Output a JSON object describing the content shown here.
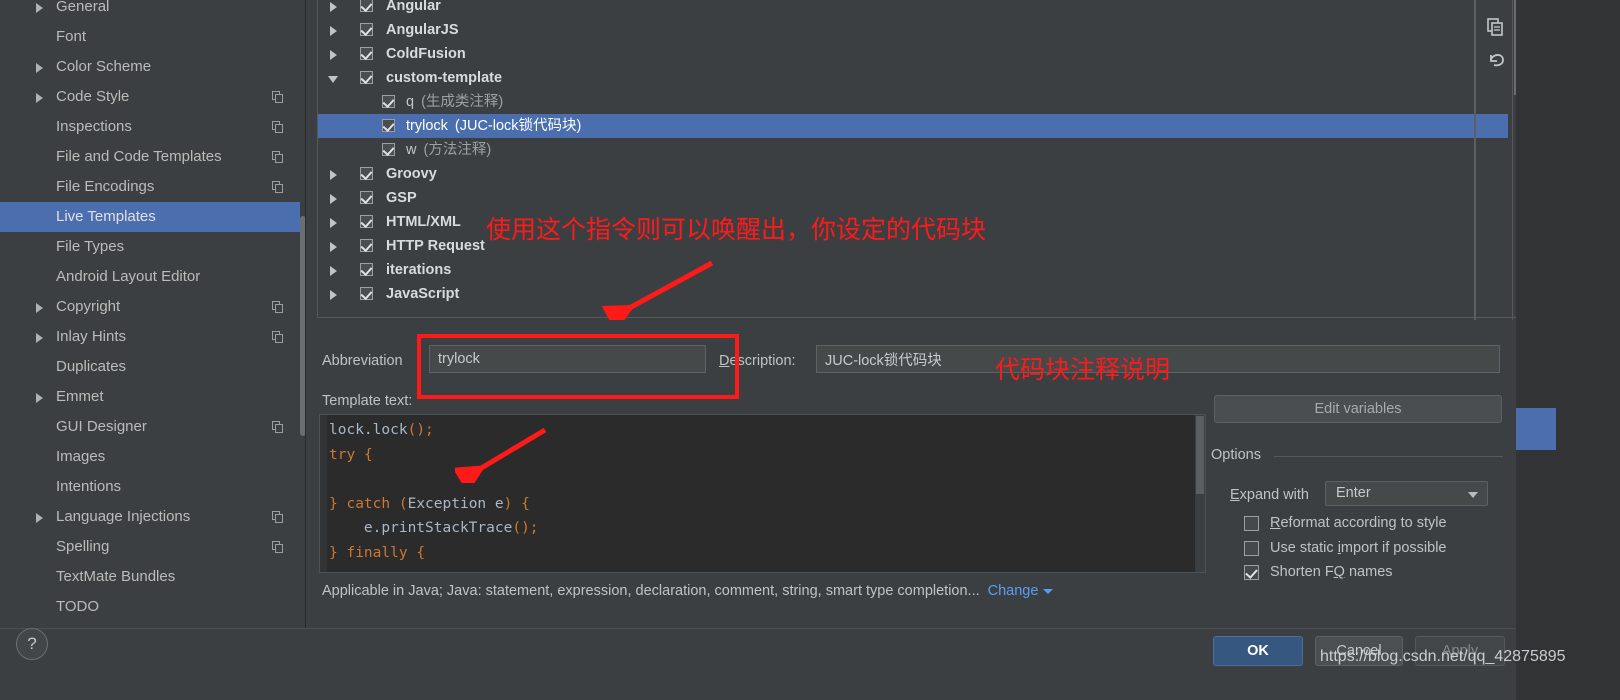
{
  "sidebar": {
    "items": [
      {
        "label": "General",
        "arrow": true,
        "copy": false,
        "selected": false
      },
      {
        "label": "Font",
        "arrow": false,
        "copy": false,
        "selected": false
      },
      {
        "label": "Color Scheme",
        "arrow": true,
        "copy": false,
        "selected": false
      },
      {
        "label": "Code Style",
        "arrow": true,
        "copy": true,
        "selected": false
      },
      {
        "label": "Inspections",
        "arrow": false,
        "copy": true,
        "selected": false
      },
      {
        "label": "File and Code Templates",
        "arrow": false,
        "copy": true,
        "selected": false
      },
      {
        "label": "File Encodings",
        "arrow": false,
        "copy": true,
        "selected": false
      },
      {
        "label": "Live Templates",
        "arrow": false,
        "copy": false,
        "selected": true
      },
      {
        "label": "File Types",
        "arrow": false,
        "copy": false,
        "selected": false
      },
      {
        "label": "Android Layout Editor",
        "arrow": false,
        "copy": false,
        "selected": false
      },
      {
        "label": "Copyright",
        "arrow": true,
        "copy": true,
        "selected": false
      },
      {
        "label": "Inlay Hints",
        "arrow": true,
        "copy": true,
        "selected": false
      },
      {
        "label": "Duplicates",
        "arrow": false,
        "copy": false,
        "selected": false
      },
      {
        "label": "Emmet",
        "arrow": true,
        "copy": false,
        "selected": false
      },
      {
        "label": "GUI Designer",
        "arrow": false,
        "copy": true,
        "selected": false
      },
      {
        "label": "Images",
        "arrow": false,
        "copy": false,
        "selected": false
      },
      {
        "label": "Intentions",
        "arrow": false,
        "copy": false,
        "selected": false
      },
      {
        "label": "Language Injections",
        "arrow": true,
        "copy": true,
        "selected": false
      },
      {
        "label": "Spelling",
        "arrow": false,
        "copy": true,
        "selected": false
      },
      {
        "label": "TextMate Bundles",
        "arrow": false,
        "copy": false,
        "selected": false
      },
      {
        "label": "TODO",
        "arrow": false,
        "copy": false,
        "selected": false
      }
    ]
  },
  "tree": {
    "rows": [
      {
        "label": "Angular",
        "note": "",
        "level": "parent",
        "arrow": "closed",
        "checked": true,
        "selected": false
      },
      {
        "label": "AngularJS",
        "note": "",
        "level": "parent",
        "arrow": "closed",
        "checked": true,
        "selected": false
      },
      {
        "label": "ColdFusion",
        "note": "",
        "level": "parent",
        "arrow": "closed",
        "checked": true,
        "selected": false
      },
      {
        "label": "custom-template",
        "note": "",
        "level": "parent",
        "arrow": "open",
        "checked": true,
        "selected": false
      },
      {
        "label": "q",
        "note": "(生成类注释)",
        "level": "child",
        "arrow": "none",
        "checked": true,
        "selected": false
      },
      {
        "label": "trylock",
        "note": "(JUC-lock锁代码块)",
        "level": "child",
        "arrow": "none",
        "checked": true,
        "selected": true
      },
      {
        "label": "w",
        "note": "(方法注释)",
        "level": "child",
        "arrow": "none",
        "checked": true,
        "selected": false
      },
      {
        "label": "Groovy",
        "note": "",
        "level": "parent",
        "arrow": "closed",
        "checked": true,
        "selected": false
      },
      {
        "label": "GSP",
        "note": "",
        "level": "parent",
        "arrow": "closed",
        "checked": true,
        "selected": false
      },
      {
        "label": "HTML/XML",
        "note": "",
        "level": "parent",
        "arrow": "closed",
        "checked": true,
        "selected": false
      },
      {
        "label": "HTTP Request",
        "note": "",
        "level": "parent",
        "arrow": "closed",
        "checked": true,
        "selected": false
      },
      {
        "label": "iterations",
        "note": "",
        "level": "parent",
        "arrow": "closed",
        "checked": true,
        "selected": false
      },
      {
        "label": "JavaScript",
        "note": "",
        "level": "parent",
        "arrow": "closed",
        "checked": true,
        "selected": false
      }
    ]
  },
  "form": {
    "abbreviation_label": "Abbreviation",
    "abbreviation_label_accel": "A",
    "abbreviation_label_rest": "bbreviation",
    "abbreviation_value": "trylock",
    "description_label_accel": "D",
    "description_label_rest": "escription:",
    "description_value": "JUC-lock锁代码块",
    "template_text_label": "Template text:",
    "template_code": "lock.lock();\ntry {\n\n} catch (Exception e) {\n    e.printStackTrace();\n} finally {",
    "applicable_text": "Applicable in Java; Java: statement, expression, declaration, comment, string, smart type completion...",
    "change_link": "Change"
  },
  "options": {
    "edit_variables_label": "Edit variables",
    "title": "Options",
    "expand_with_label_accel": "E",
    "expand_with_label_rest": "xpand with",
    "expand_with_value": "Enter",
    "checkboxes": [
      {
        "accel": "R",
        "rest": "eformat according to style",
        "prefix": "",
        "checked": false
      },
      {
        "accel": "i",
        "rest": "mport if possible",
        "prefix": "Use static ",
        "checked": false
      },
      {
        "accel": "Q",
        "rest": " names",
        "prefix": "Shorten F",
        "checked": true
      }
    ]
  },
  "buttons": {
    "ok": "OK",
    "cancel": "Cancel",
    "apply": "Apply",
    "help": "?"
  },
  "annotations": {
    "note_tree": "使用这个指令则可以唤醒出，你设定的代码块",
    "note_description": "代码块注释说明",
    "watermark": "https://blog.csdn.net/qq_42875895"
  },
  "colors": {
    "selection": "#4b6eaf",
    "accent_link": "#589df6",
    "annotation_red": "#ff1a1a",
    "panel_bg": "#3c3f41",
    "editor_bg": "#2b2b2b"
  }
}
